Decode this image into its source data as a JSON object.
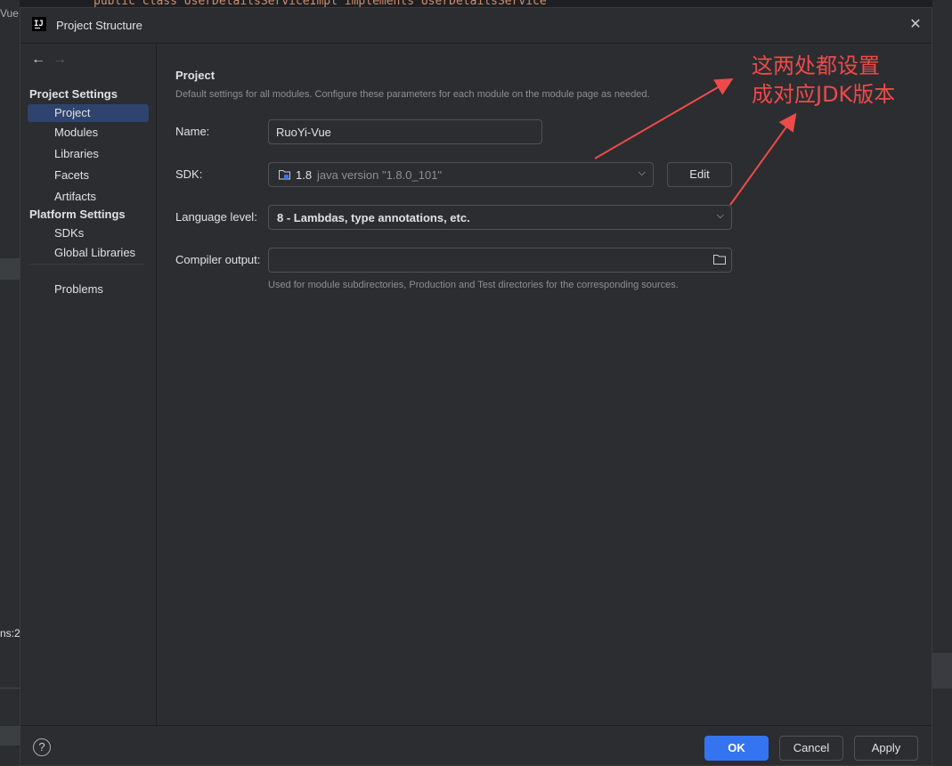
{
  "background": {
    "code_line": "public class UserDetailsServiceImpl implements UserDetailsService",
    "left_text_top": "Vue",
    "left_text_bottom": "ns:2."
  },
  "dialog": {
    "title": "Project Structure",
    "close_glyph": "✕"
  },
  "sidebar": {
    "back_glyph": "←",
    "forward_glyph": "→",
    "project_settings_label": "Project Settings",
    "platform_settings_label": "Platform Settings",
    "items": [
      {
        "label": "Project"
      },
      {
        "label": "Modules"
      },
      {
        "label": "Libraries"
      },
      {
        "label": "Facets"
      },
      {
        "label": "Artifacts"
      },
      {
        "label": "SDKs"
      },
      {
        "label": "Global Libraries"
      },
      {
        "label": "Problems"
      }
    ]
  },
  "content": {
    "title": "Project",
    "description": "Default settings for all modules. Configure these parameters for each module on the module page as needed.",
    "name_label": "Name:",
    "name_value": "RuoYi-Vue",
    "sdk_label": "SDK:",
    "sdk_version": "1.8",
    "sdk_detail": "java version \"1.8.0_101\"",
    "edit_label": "Edit",
    "language_label": "Language level:",
    "language_value": "8 - Lambdas, type annotations, etc.",
    "compiler_label": "Compiler output:",
    "compiler_value": "",
    "compiler_hint": "Used for module subdirectories, Production and Test directories for the corresponding sources."
  },
  "footer": {
    "help_glyph": "?",
    "ok_label": "OK",
    "cancel_label": "Cancel",
    "apply_label": "Apply"
  },
  "annotation": {
    "line1": "这两处都设置",
    "line2": "成对应JDK版本",
    "color": "#ee4a4a"
  }
}
